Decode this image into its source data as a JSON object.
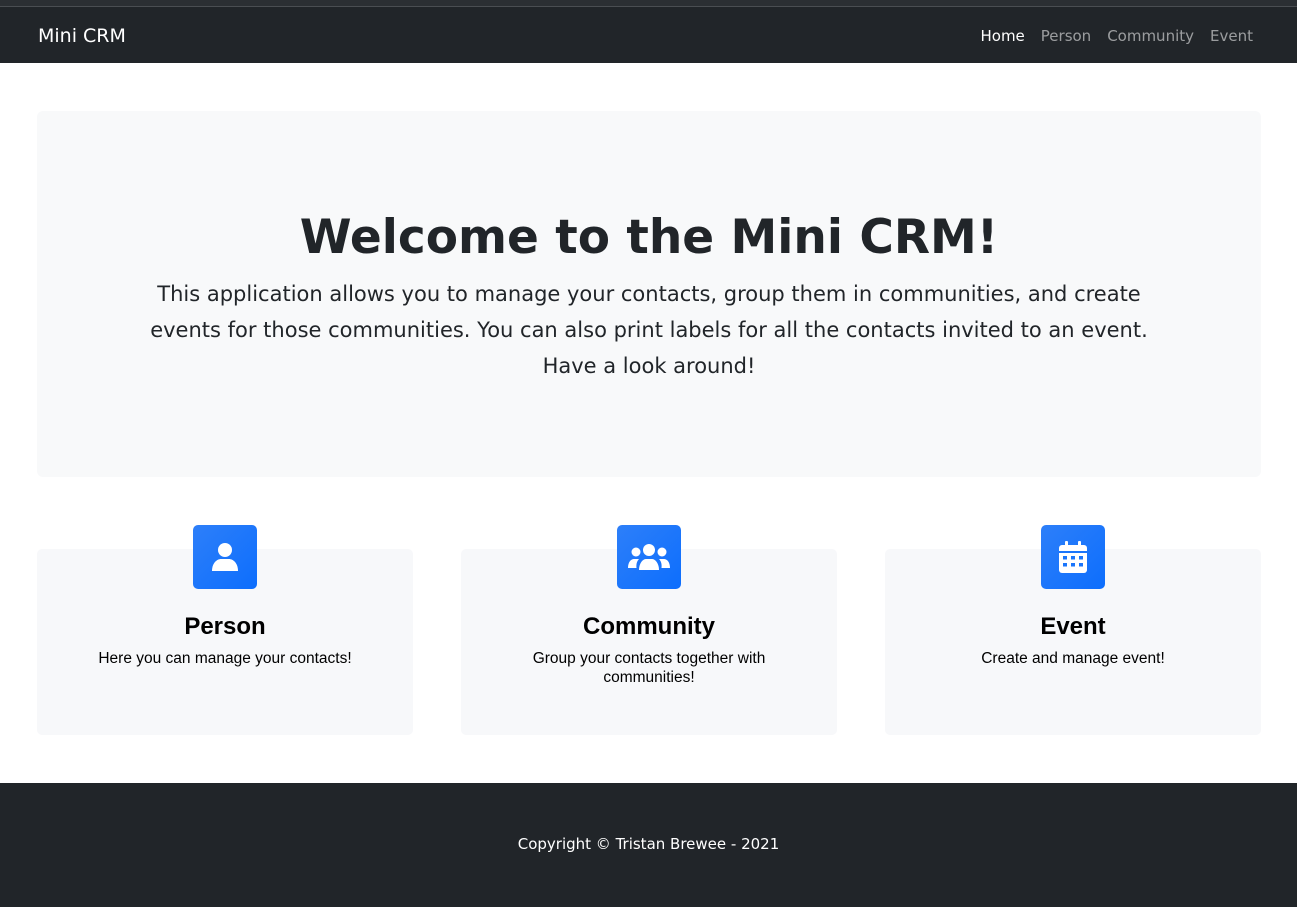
{
  "navbar": {
    "brand": "Mini CRM",
    "links": [
      {
        "label": "Home",
        "active": true
      },
      {
        "label": "Person",
        "active": false
      },
      {
        "label": "Community",
        "active": false
      },
      {
        "label": "Event",
        "active": false
      }
    ]
  },
  "hero": {
    "title": "Welcome to the Mini CRM!",
    "text": "This application allows you to manage your contacts, group them in communities, and create events for those communities. You can also print labels for all the contacts invited to an event. Have a look around!"
  },
  "cards": [
    {
      "icon": "user-icon",
      "title": "Person",
      "text": "Here you can manage your contacts!"
    },
    {
      "icon": "users-icon",
      "title": "Community",
      "text": "Group your contacts together with communities!"
    },
    {
      "icon": "calendar-icon",
      "title": "Event",
      "text": "Create and manage event!"
    }
  ],
  "footer": {
    "text": "Copyright © Tristan Brewee - 2021"
  },
  "colors": {
    "navbar_bg": "#212529",
    "accent": "#0d6efd",
    "hero_bg": "#f8f9fa"
  }
}
